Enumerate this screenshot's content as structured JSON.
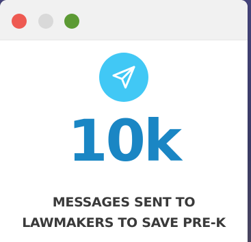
{
  "window": {
    "controls": {
      "close_color": "#ee5a52",
      "minimize_color": "#d9d9d9",
      "zoom_color": "#5c9a34"
    }
  },
  "stat": {
    "icon": "paper-plane-send-icon",
    "icon_bg_color": "#41c8f5",
    "value": "10k",
    "value_color": "#1a86c4",
    "caption_line1": "MESSAGES SENT TO",
    "caption_line2": "LAWMAKERS TO SAVE PRE-K"
  }
}
